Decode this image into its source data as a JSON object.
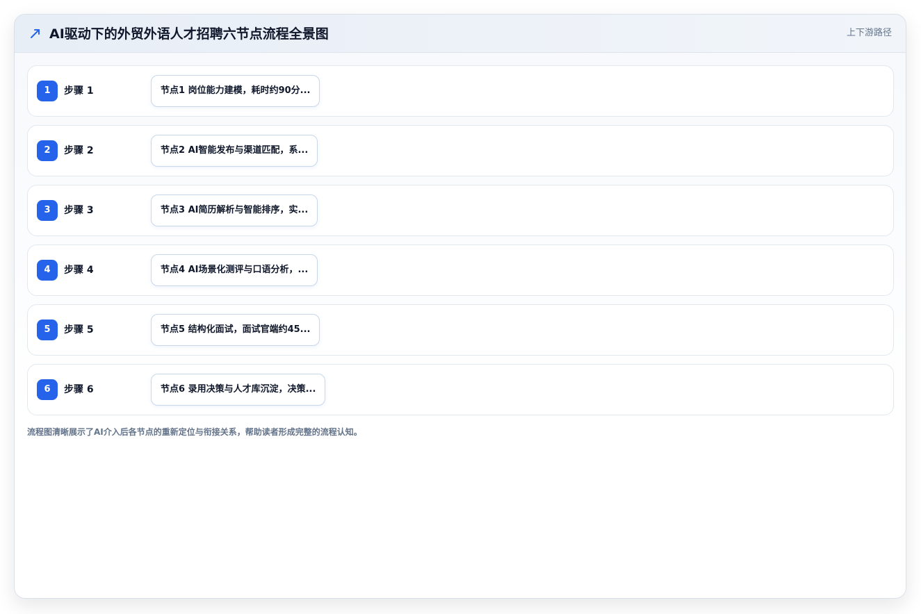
{
  "header": {
    "icon": "trend-arrow-icon",
    "title": "AI驱动下的外贸外语人才招聘六节点流程全景图",
    "route_label": "上下游路径"
  },
  "steps": [
    {
      "number": "1",
      "label": "步骤 1",
      "node_text": "节点1 岗位能力建模，耗时约90分..."
    },
    {
      "number": "2",
      "label": "步骤 2",
      "node_text": "节点2 AI智能发布与渠道匹配，系..."
    },
    {
      "number": "3",
      "label": "步骤 3",
      "node_text": "节点3 AI简历解析与智能排序，实..."
    },
    {
      "number": "4",
      "label": "步骤 4",
      "node_text": "节点4 AI场景化测评与口语分析，..."
    },
    {
      "number": "5",
      "label": "步骤 5",
      "node_text": "节点5 结构化面试，面试官端约45..."
    },
    {
      "number": "6",
      "label": "步骤 6",
      "node_text": "节点6 录用决策与人才库沉淀，决策..."
    }
  ],
  "caption": "流程图清晰展示了AI介入后各节点的重新定位与衔接关系，帮助读者形成完整的流程认知。",
  "colors": {
    "accent": "#2563eb",
    "title_text": "#0f172a",
    "muted_text": "#64748b",
    "border": "#e2e8f0"
  }
}
